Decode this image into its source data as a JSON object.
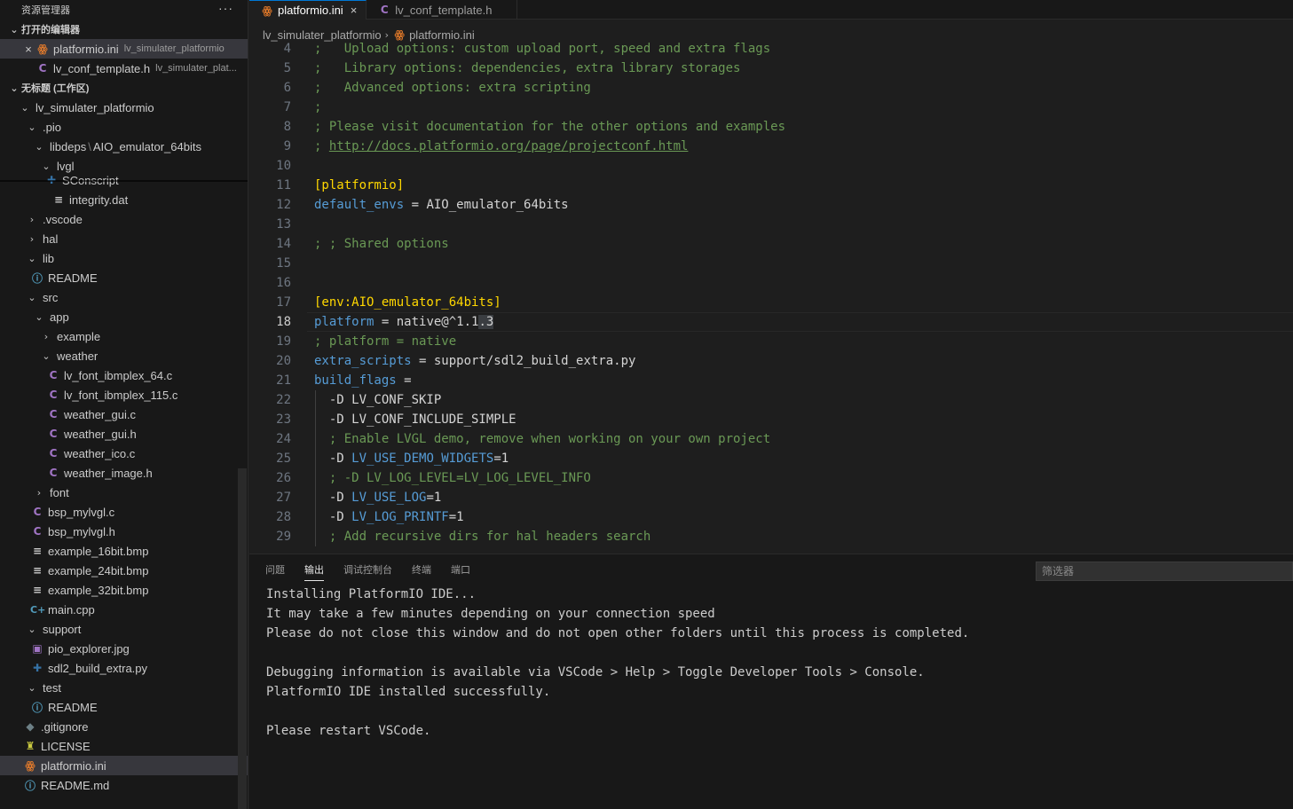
{
  "sidebar": {
    "title": "资源管理器",
    "more": "···",
    "open_editors_header": "打开的编辑器",
    "open_editors": [
      {
        "name": "platformio.ini",
        "desc": "lv_simulater_platformio"
      },
      {
        "name": "lv_conf_template.h",
        "desc": "lv_simulater_plat..."
      }
    ],
    "workspace_header": "无标题 (工作区)",
    "tree": [
      {
        "label": "lv_simulater_platformio",
        "path_sep": "",
        "path_tail": ""
      },
      {
        "label": ".pio"
      },
      {
        "label": "libdeps",
        "path_sep": "\\",
        "path_tail": "AIO_emulator_64bits"
      },
      {
        "label": "lvgl"
      },
      {
        "label": "SConscript"
      },
      {
        "label": "integrity.dat"
      },
      {
        "label": ".vscode"
      },
      {
        "label": "hal"
      },
      {
        "label": "lib"
      },
      {
        "label": "README"
      },
      {
        "label": "src"
      },
      {
        "label": "app"
      },
      {
        "label": "example"
      },
      {
        "label": "weather"
      },
      {
        "label": "lv_font_ibmplex_64.c"
      },
      {
        "label": "lv_font_ibmplex_115.c"
      },
      {
        "label": "weather_gui.c"
      },
      {
        "label": "weather_gui.h"
      },
      {
        "label": "weather_ico.c"
      },
      {
        "label": "weather_image.h"
      },
      {
        "label": "font"
      },
      {
        "label": "bsp_mylvgl.c"
      },
      {
        "label": "bsp_mylvgl.h"
      },
      {
        "label": "example_16bit.bmp"
      },
      {
        "label": "example_24bit.bmp"
      },
      {
        "label": "example_32bit.bmp"
      },
      {
        "label": "main.cpp"
      },
      {
        "label": "support"
      },
      {
        "label": "pio_explorer.jpg"
      },
      {
        "label": "sdl2_build_extra.py"
      },
      {
        "label": "test"
      },
      {
        "label": "README"
      },
      {
        "label": ".gitignore"
      },
      {
        "label": "LICENSE"
      },
      {
        "label": "platformio.ini"
      },
      {
        "label": "README.md"
      }
    ]
  },
  "tabs": [
    {
      "label": "platformio.ini",
      "close": "×"
    },
    {
      "label": "lv_conf_template.h"
    }
  ],
  "breadcrumb": {
    "folder": "lv_simulater_platformio",
    "file": "platformio.ini"
  },
  "editor": {
    "lines": [
      {
        "n": "4",
        "parts": [
          [
            "cm",
            ";   Upload options: custom upload port, speed and extra flags"
          ]
        ]
      },
      {
        "n": "5",
        "parts": [
          [
            "cm",
            ";   Library options: dependencies, extra library storages"
          ]
        ]
      },
      {
        "n": "6",
        "parts": [
          [
            "cm",
            ";   Advanced options: extra scripting"
          ]
        ]
      },
      {
        "n": "7",
        "parts": [
          [
            "cm",
            ";"
          ]
        ]
      },
      {
        "n": "8",
        "parts": [
          [
            "cm",
            "; Please visit documentation for the other options and examples"
          ]
        ]
      },
      {
        "n": "9",
        "parts": [
          [
            "cm",
            "; "
          ],
          [
            "lnk",
            "http://docs.platformio.org/page/projectconf.html"
          ]
        ]
      },
      {
        "n": "10",
        "parts": []
      },
      {
        "n": "11",
        "parts": [
          [
            "sec",
            "[platformio]"
          ]
        ]
      },
      {
        "n": "12",
        "parts": [
          [
            "key",
            "default_envs"
          ],
          [
            "",
            " = AIO_emulator_64bits"
          ]
        ]
      },
      {
        "n": "13",
        "parts": []
      },
      {
        "n": "14",
        "parts": [
          [
            "cm",
            "; ; Shared options"
          ]
        ]
      },
      {
        "n": "15",
        "parts": []
      },
      {
        "n": "16",
        "parts": []
      },
      {
        "n": "17",
        "parts": [
          [
            "sec",
            "[env:AIO_emulator_64bits]"
          ]
        ]
      },
      {
        "n": "18",
        "parts": [
          [
            "key",
            "platform"
          ],
          [
            "",
            " = native@^1.1"
          ],
          [
            "sel",
            ".3"
          ]
        ]
      },
      {
        "n": "19",
        "parts": [
          [
            "cm",
            "; platform = native"
          ]
        ]
      },
      {
        "n": "20",
        "parts": [
          [
            "key",
            "extra_scripts"
          ],
          [
            "",
            " = support/sdl2_build_extra.py"
          ]
        ]
      },
      {
        "n": "21",
        "parts": [
          [
            "key",
            "build_flags"
          ],
          [
            "",
            " ="
          ]
        ]
      },
      {
        "n": "22",
        "parts": [
          [
            "",
            "  -D LV_CONF_SKIP"
          ]
        ]
      },
      {
        "n": "23",
        "parts": [
          [
            "",
            "  -D LV_CONF_INCLUDE_SIMPLE"
          ]
        ]
      },
      {
        "n": "24",
        "parts": [
          [
            "cm",
            "  ; Enable LVGL demo, remove when working on your own project"
          ]
        ]
      },
      {
        "n": "25",
        "parts": [
          [
            "",
            "  -D "
          ],
          [
            "key",
            "LV_USE_DEMO_WIDGETS"
          ],
          [
            "",
            "=1"
          ]
        ]
      },
      {
        "n": "26",
        "parts": [
          [
            "cm",
            "  ; -D LV_LOG_LEVEL=LV_LOG_LEVEL_INFO"
          ]
        ]
      },
      {
        "n": "27",
        "parts": [
          [
            "",
            "  -D "
          ],
          [
            "key",
            "LV_USE_LOG"
          ],
          [
            "",
            "=1"
          ]
        ]
      },
      {
        "n": "28",
        "parts": [
          [
            "",
            "  -D "
          ],
          [
            "key",
            "LV_LOG_PRINTF"
          ],
          [
            "",
            "=1"
          ]
        ]
      },
      {
        "n": "29",
        "parts": [
          [
            "cm",
            "  ; Add recursive dirs for hal headers search"
          ]
        ]
      }
    ]
  },
  "panel": {
    "tabs": [
      "问题",
      "输出",
      "调试控制台",
      "终端",
      "端口"
    ],
    "active_tab": "输出",
    "filter_placeholder": "筛选器",
    "output": [
      "Installing PlatformIO IDE...",
      "It may take a few minutes depending on your connection speed",
      "Please do not close this window and do not open other folders until this process is completed.",
      "",
      "Debugging information is available via VSCode > Help > Toggle Developer Tools > Console.",
      "PlatformIO IDE installed successfully.",
      "",
      "Please restart VSCode."
    ]
  },
  "colors": {
    "accent": "#0078d4",
    "comment": "#6a9955",
    "keyword": "#569cd6",
    "section": "#ffd700",
    "c_icon": "#a074c4"
  }
}
